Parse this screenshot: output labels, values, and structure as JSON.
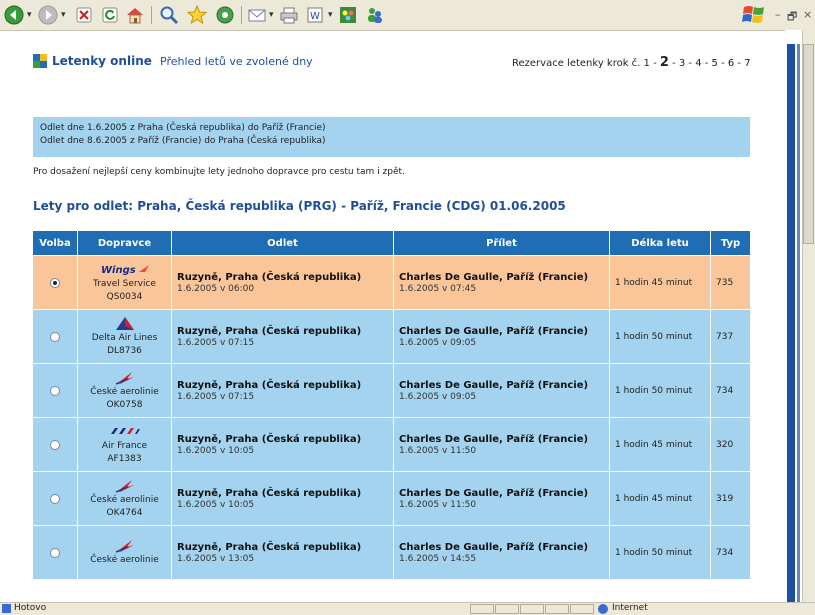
{
  "browser": {
    "toolbar_icons": [
      "back-icon",
      "forward-icon",
      "stop-icon",
      "refresh-icon",
      "home-icon",
      "search-icon",
      "favorites-icon",
      "media-icon",
      "mail-icon",
      "print-icon",
      "edit-icon",
      "messenger-icon",
      "contacts-icon"
    ],
    "window_controls": [
      "–",
      "🗗",
      "×"
    ]
  },
  "header": {
    "brand": "Letenky online",
    "subtitle": "Přehled letů ve zvolené dny",
    "steps_prefix": "Rezervace letenky krok č. 1 - ",
    "steps_current": "2",
    "steps_suffix": " - 3 - 4 - 5 - 6 - 7"
  },
  "info": {
    "line1": "Odlet dne 1.6.2005 z Praha (Česká republika) do Paříž (Francie)",
    "line2": "Odlet dne 8.6.2005 z Paříž (Francie) do Praha (Česká republika)"
  },
  "note": "Pro dosažení nejlepší ceny kombinujte lety jednoho dopravce pro cestu tam i zpět.",
  "section_title": "Lety pro odlet: Praha, Česká republika (PRG) - Paříž, Francie (CDG) 01.06.2005",
  "table": {
    "headers": [
      "Volba",
      "Dopravce",
      "Odlet",
      "Přílet",
      "Délka letu",
      "Typ"
    ],
    "rows": [
      {
        "selected": true,
        "airline": "Travel Service",
        "flight": "QS0034",
        "logo": "smartwings-logo",
        "dep_place": "Ruzyně, Praha (Česká republika)",
        "dep_time": "1.6.2005 v 06:00",
        "arr_place": "Charles De Gaulle, Paříž (Francie)",
        "arr_time": "1.6.2005 v 07:45",
        "duration": "1 hodin 45 minut",
        "type": "735"
      },
      {
        "selected": false,
        "airline": "Delta Air Lines",
        "flight": "DL8736",
        "logo": "delta-logo",
        "dep_place": "Ruzyně, Praha (Česká republika)",
        "dep_time": "1.6.2005 v 07:15",
        "arr_place": "Charles De Gaulle, Paříž (Francie)",
        "arr_time": "1.6.2005 v 09:05",
        "duration": "1 hodin 50 minut",
        "type": "737"
      },
      {
        "selected": false,
        "airline": "České aerolinie",
        "flight": "OK0758",
        "logo": "csa-logo",
        "dep_place": "Ruzyně, Praha (Česká republika)",
        "dep_time": "1.6.2005 v 07:15",
        "arr_place": "Charles De Gaulle, Paříž (Francie)",
        "arr_time": "1.6.2005 v 09:05",
        "duration": "1 hodin 50 minut",
        "type": "734"
      },
      {
        "selected": false,
        "airline": "Air France",
        "flight": "AF1383",
        "logo": "airfrance-logo",
        "dep_place": "Ruzyně, Praha (Česká republika)",
        "dep_time": "1.6.2005 v 10:05",
        "arr_place": "Charles De Gaulle, Paříž (Francie)",
        "arr_time": "1.6.2005 v 11:50",
        "duration": "1 hodin 45 minut",
        "type": "320"
      },
      {
        "selected": false,
        "airline": "České aerolinie",
        "flight": "OK4764",
        "logo": "csa-logo",
        "dep_place": "Ruzyně, Praha (Česká republika)",
        "dep_time": "1.6.2005 v 10:05",
        "arr_place": "Charles De Gaulle, Paříž (Francie)",
        "arr_time": "1.6.2005 v 11:50",
        "duration": "1 hodin 45 minut",
        "type": "319"
      },
      {
        "selected": false,
        "airline": "České aerolinie",
        "flight": "",
        "logo": "csa-logo",
        "dep_place": "Ruzyně, Praha (Česká republika)",
        "dep_time": "1.6.2005 v 13:05",
        "arr_place": "Charles De Gaulle, Paříž (Francie)",
        "arr_time": "1.6.2005 v 14:55",
        "duration": "1 hodin 50 minut",
        "type": "734"
      }
    ]
  },
  "status": {
    "text": "Hotovo",
    "zone": "Internet"
  },
  "colors": {
    "header_blue": "#1f6db4",
    "row_selected": "#fbc59a",
    "row_normal": "#a3d3ee",
    "brand_blue": "#1f4f9b"
  }
}
